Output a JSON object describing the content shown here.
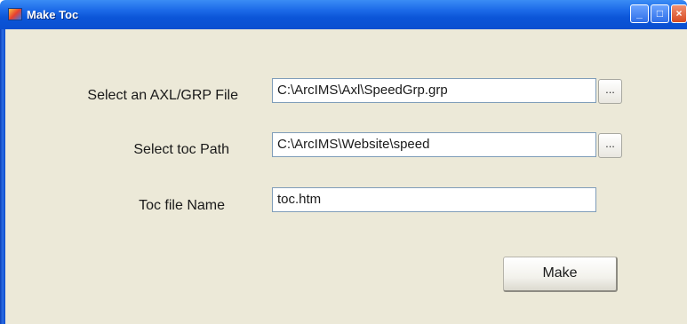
{
  "window": {
    "title": "Make Toc",
    "icon": "app-icon",
    "controls": {
      "minimize": "minimize-icon",
      "maximize": "maximize-icon",
      "close": "close-icon"
    }
  },
  "form": {
    "axl_label": "Select an AXL/GRP File",
    "axl_value": "C:\\ArcIMS\\Axl\\SpeedGrp.grp",
    "toc_path_label": "Select toc Path",
    "toc_path_value": "C:\\ArcIMS\\Website\\speed",
    "toc_name_label": "Toc file Name",
    "toc_name_value": "toc.htm",
    "browse_label": "...",
    "make_label": "Make"
  }
}
